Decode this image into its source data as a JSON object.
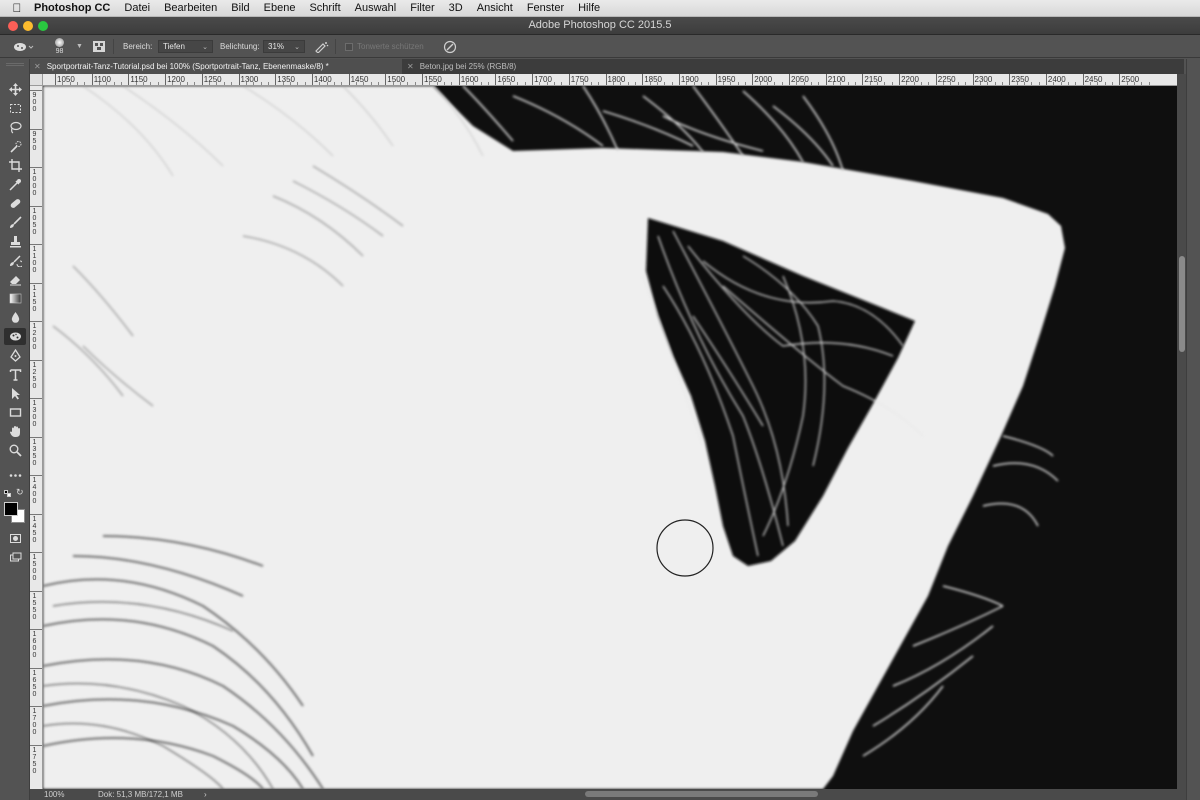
{
  "menubar": {
    "app_name": "Photoshop CC",
    "items": [
      "Datei",
      "Bearbeiten",
      "Bild",
      "Ebene",
      "Schrift",
      "Auswahl",
      "Filter",
      "3D",
      "Ansicht",
      "Fenster",
      "Hilfe"
    ]
  },
  "window": {
    "title": "Adobe Photoshop CC 2015.5"
  },
  "options_bar": {
    "brush_size": "98",
    "range_label": "Bereich:",
    "range_value": "Tiefen",
    "exposure_label": "Belichtung:",
    "exposure_value": "31%",
    "protect_tones_label": "Tonwerte schützen"
  },
  "tabs": [
    {
      "label": "Sportportrait-Tanz-Tutorial.psd bei 100% (Sportportrait-Tanz, Ebenenmaske/8) *",
      "active": true
    },
    {
      "label": "Beton.jpg bei 25% (RGB/8)",
      "active": false
    }
  ],
  "ruler_top": {
    "first_label": "00",
    "labels": [
      "1050",
      "1100",
      "1150",
      "1200",
      "1250",
      "1300",
      "1350",
      "1400",
      "1450",
      "1500",
      "1550",
      "1600",
      "1650",
      "1700",
      "1750",
      "1800",
      "1850",
      "1900",
      "1950",
      "2000",
      "2050",
      "2100",
      "2150",
      "2200",
      "2250",
      "2300",
      "2350",
      "2400",
      "2450",
      "2500"
    ]
  },
  "ruler_left": {
    "labels": [
      "900",
      "950",
      "1000",
      "1050",
      "1100",
      "1150",
      "1200",
      "1250",
      "1300",
      "1350",
      "1400",
      "1450",
      "1500",
      "1550",
      "1600",
      "1650",
      "1700",
      "1750"
    ]
  },
  "toolbar": {
    "tools": [
      "move-tool",
      "marquee-tool",
      "lasso-tool",
      "quick-selection-tool",
      "crop-tool",
      "eyedropper-tool",
      "healing-brush-tool",
      "brush-tool",
      "clone-stamp-tool",
      "history-brush-tool",
      "eraser-tool",
      "gradient-tool",
      "blur-tool",
      "sponge-tool",
      "pen-tool",
      "type-tool",
      "path-selection-tool",
      "rectangle-tool",
      "hand-tool",
      "zoom-tool",
      "more-tools"
    ],
    "selected_tool": "sponge-tool",
    "foreground_color": "#000000",
    "background_color": "#ffffff"
  },
  "statusbar": {
    "zoom": "100%",
    "doc_info": "Dok: 51,3 MB/172,1 MB",
    "arrow": "›"
  }
}
